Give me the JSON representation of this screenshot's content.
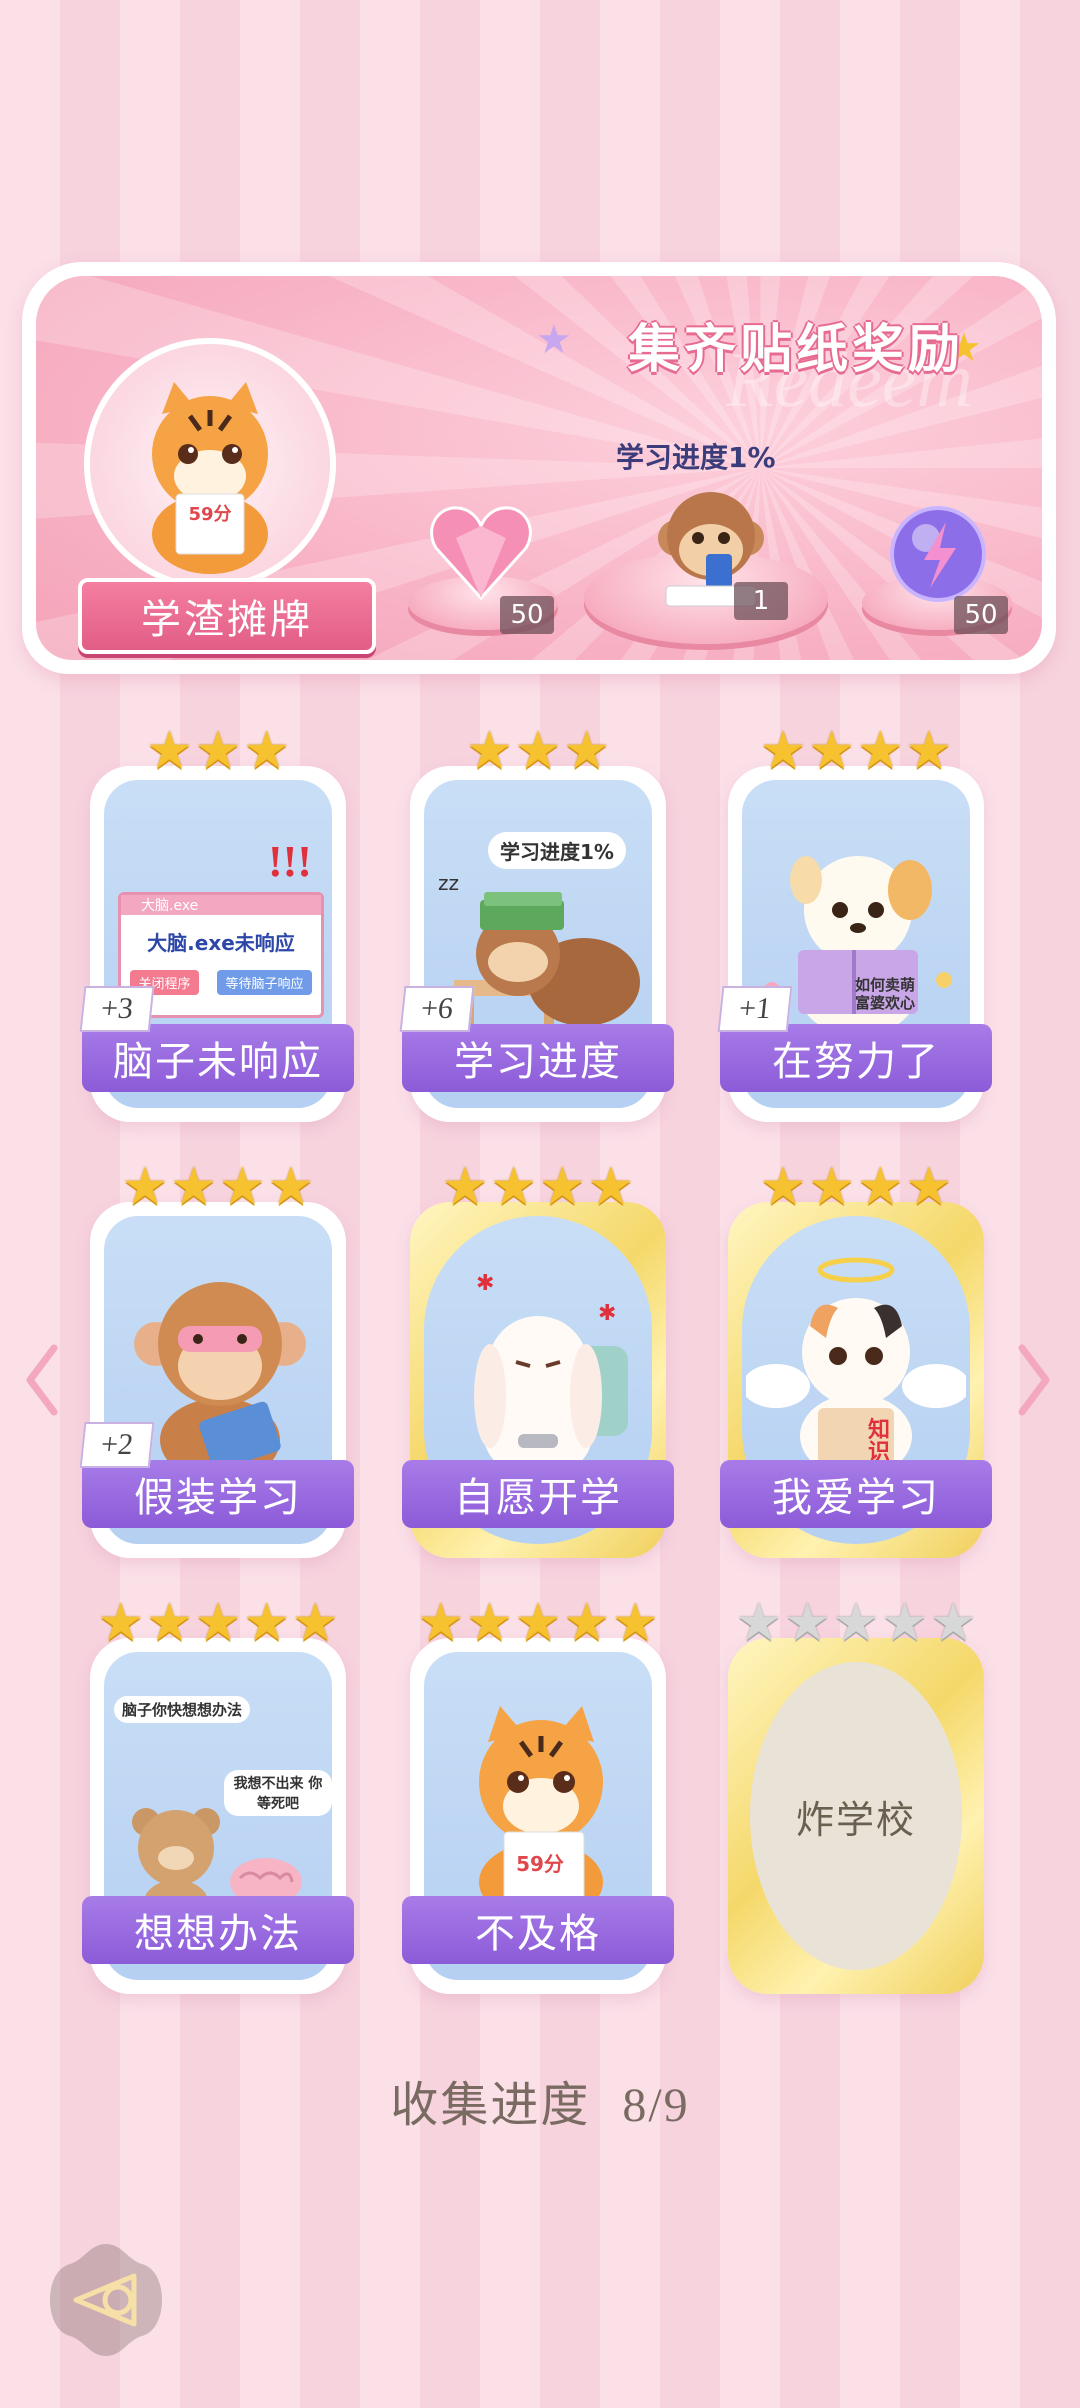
{
  "banner": {
    "title": "集齐贴纸奖励",
    "watermark": "Redeem",
    "player_title": "学渣摊牌",
    "avatar_note": "59分",
    "progress_tag": "学习进度1%",
    "rewards": [
      {
        "icon": "heart-gem-icon",
        "count": "50"
      },
      {
        "icon": "monkey-phone-icon",
        "count": "1"
      },
      {
        "icon": "lightning-orb-icon",
        "count": "50"
      }
    ]
  },
  "cards": [
    {
      "label": "脑子未响应",
      "bonus": "+3",
      "stars": 3,
      "art_text": "大脑.exe未响应",
      "btn1": "关闭程序",
      "btn2": "等待脑子响应",
      "window_title": "大脑.exe"
    },
    {
      "label": "学习进度",
      "bonus": "+6",
      "stars": 3,
      "art_text": "学习进度1%"
    },
    {
      "label": "在努力了",
      "bonus": "+1",
      "stars": 4,
      "art_text": "如何卖萌 富婆欢心"
    },
    {
      "label": "假装学习",
      "bonus": "+2",
      "stars": 4
    },
    {
      "label": "自愿开学",
      "stars": 4
    },
    {
      "label": "我爱学习",
      "stars": 4,
      "art_text": "知识"
    },
    {
      "label": "想想办法",
      "stars": 5,
      "art_text": "脑子你快想想办法",
      "art_text2": "我想不出来 你等死吧"
    },
    {
      "label": "不及格",
      "stars": 5,
      "art_text": "59分"
    },
    {
      "label": "炸学校",
      "stars": 5,
      "locked": true
    }
  ],
  "collection": {
    "label": "收集进度",
    "value": "8/9"
  },
  "colors": {
    "accent_pink": "#e25d86",
    "label_purple": "#8c5bd8",
    "star_gold": "#f6c230"
  }
}
